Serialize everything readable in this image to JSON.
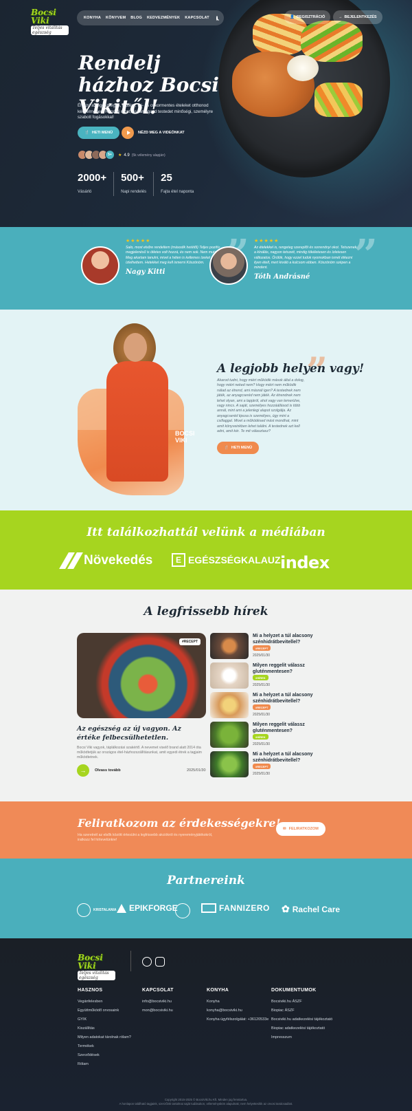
{
  "brand": {
    "logo_line1": "Bocsi Viki",
    "logo_line2": "Teljes vitalitás egészség"
  },
  "nav": {
    "items": [
      "KONYHA",
      "KÖNYVEM",
      "BLOG",
      "KEDVEZMÉNYEK",
      "KAPCSOLAT"
    ],
    "register": "REGISZTRÁCIÓ",
    "login": "BEJELENTKEZÉS"
  },
  "hero": {
    "title": "Rendelj házhoz Bocsi Vikitől!",
    "description": "Élvezd az egészséges, glutén-, tej- és cukormentes ételeket otthonod kényelmében! Rendelj most, és támogasd testedet minőségi, személyre szabott fogásokkal!",
    "menu_button": "HETI MENÜ",
    "video_button": "NÉZD MEG A VIDEÓNKAT",
    "avatars_more": "5+",
    "rating": "4.9",
    "rating_note": "(5k vélemény alapján)",
    "stats": [
      {
        "value": "2000+",
        "label": "Vásárló"
      },
      {
        "value": "500+",
        "label": "Napi rendelés"
      },
      {
        "value": "25",
        "label": "Fajta étel naponta"
      }
    ]
  },
  "testimonials": [
    {
      "stars": "★★★★★",
      "text": "Salo, most elsőre rendeltem (második hetétől) Teljes pozitív megjelenésű is ötletes volt hozzá, és nem sok. Nem mutattam. Meg akartam tanulni, mivel a héten is kellemes ízeket ízlelhettem. Hetekkel meg kell ismerni Köszönöm.",
      "name": "Nagy Kitti"
    },
    {
      "stars": "★★★★★",
      "text": "Az ételekkel is, rengeteg szereplőt és sorrendnyi okot. Tetszenek a kínálás, nagyon tetszett, mindig tökéletesen és ízletesen változatos. Örülök, hogy ezzel tudok nyomokban ismét étkezni ilyen ételt, mert kiváló a kulcsom ebben. Köszönöm szépen a mindent.",
      "name": "Tóth Andrásné"
    }
  ],
  "about": {
    "title": "A legjobb helyen vagy!",
    "text": "Akarod tudni, hogy miért működik mások által a dolog, hogy miért neked nem? Hogy miért nem működik nálad az étrend, ami másnál igen? A testednek nem játék, az anyagcseréd nem játék. Az étrendnek nem lehet olyan, ami a lapjáról, ahol vagy van lemerülve, vagy nincs. A saját, személyes hozzáállásod is több annál, mint ami a jelenlegi alapot szolgálja. Az anyagcseréd tipusa is személyes, úgy mint a csillaggal. Mivel a működésed mást mondhat, mint amit könyveinkben lehet találni. A testednek azt kell adni, amit kér. Te mit választasz?",
    "badge": "BOCSI VIKI",
    "button": "HETI MENÜ"
  },
  "media": {
    "title": "Itt találkozhattál velünk a médiában",
    "logos": [
      "Növekedés",
      "EGÉSZSÉGKALAUZ",
      "index"
    ]
  },
  "news": {
    "title": "A legfrissebb hírek",
    "featured": {
      "tag": "#RECEPT",
      "title": "Az egészség az új vagyon. Az értéke felbecsülhetetlen.",
      "desc": "Bocsi Viki vagyok, táplálkozási szakértő. A nevemet viselő brand alatt 2014 óta működtetjük az országos étel-házhozszállításunkat, amit egyedi étrek a tagjaim működtetnek.",
      "readmore": "Olvass tovább",
      "date": "2025/01/30"
    },
    "items": [
      {
        "title": "Mi a helyzet a túl alacsony szénhidrátbevitellel?",
        "badge": "#RECEPT",
        "date": "2025/01/30"
      },
      {
        "title": "Milyen reggelit válassz gluténmentesen?",
        "badge": "#HÍREK",
        "date": "2025/01/30"
      },
      {
        "title": "Mi a helyzet a túl alacsony szénhidrátbevitellel?",
        "badge": "#RECEPT",
        "date": "2025/01/30"
      },
      {
        "title": "Milyen reggelit válassz gluténmentesen?",
        "badge": "#HÍREK",
        "date": "2025/01/30"
      },
      {
        "title": "Mi a helyzet a túl alacsony szénhidrátbevitellel?",
        "badge": "#RECEPT",
        "date": "2025/01/30"
      }
    ]
  },
  "newsletter": {
    "title": "Feliratkozom az érdekességekre!",
    "text": "Ha szeretnél az elsők között értesülni a legfrissebb akciókról és nyereményjátékokról, iratkozz fel hírlevelünkre!",
    "button": "FELIRATKOZOM"
  },
  "partners": {
    "title": "Partnereink",
    "logos": [
      "KRISTALANIA",
      "EPIKFORGE",
      "FANNIZERO",
      "Rachel Care"
    ]
  },
  "footer": {
    "columns": [
      {
        "title": "HASZNOS",
        "links": [
          "Vegánfelesben",
          "Együttműködő orvosaink",
          "GYIK",
          "Kiszállítás",
          "Milyen adatokat tárolnak rólam?",
          "Termékek",
          "Szerződések",
          "Rólam"
        ]
      },
      {
        "title": "KAPCSOLAT",
        "links": [
          "info@bocsiviki.hu",
          "mon@bocsiviki.hu"
        ]
      },
      {
        "title": "KONYHA",
        "links": [
          "Konyha",
          "konyha@bocsiviki.hu",
          "Konyha ügyfélszolgálat: +36120533e"
        ]
      },
      {
        "title": "DOKUMENTUMOK",
        "links": [
          "Bocsiviki.hu ÁSZF",
          "Biopiac ÁSZF",
          "Bocsiviki.hu adatkezelési tájékoztató",
          "Biopiac adatkezelési tájékoztató",
          "Impresszum"
        ]
      }
    ],
    "copyright": "Copyright 2015-2025 © BocsiViki.hu Kft. Minden jog fenntartva.",
    "disclaimer": "A honlapon található tagjaink, szerzőink tartalmai saját tudásukon, véleményükön alapulnak; nem helyettesítik az orvosi tanácsadást."
  },
  "colors": {
    "teal": "#4aafbc",
    "lime": "#a6d51f",
    "orange": "#f08a4d",
    "dark": "#1d2a3a"
  }
}
